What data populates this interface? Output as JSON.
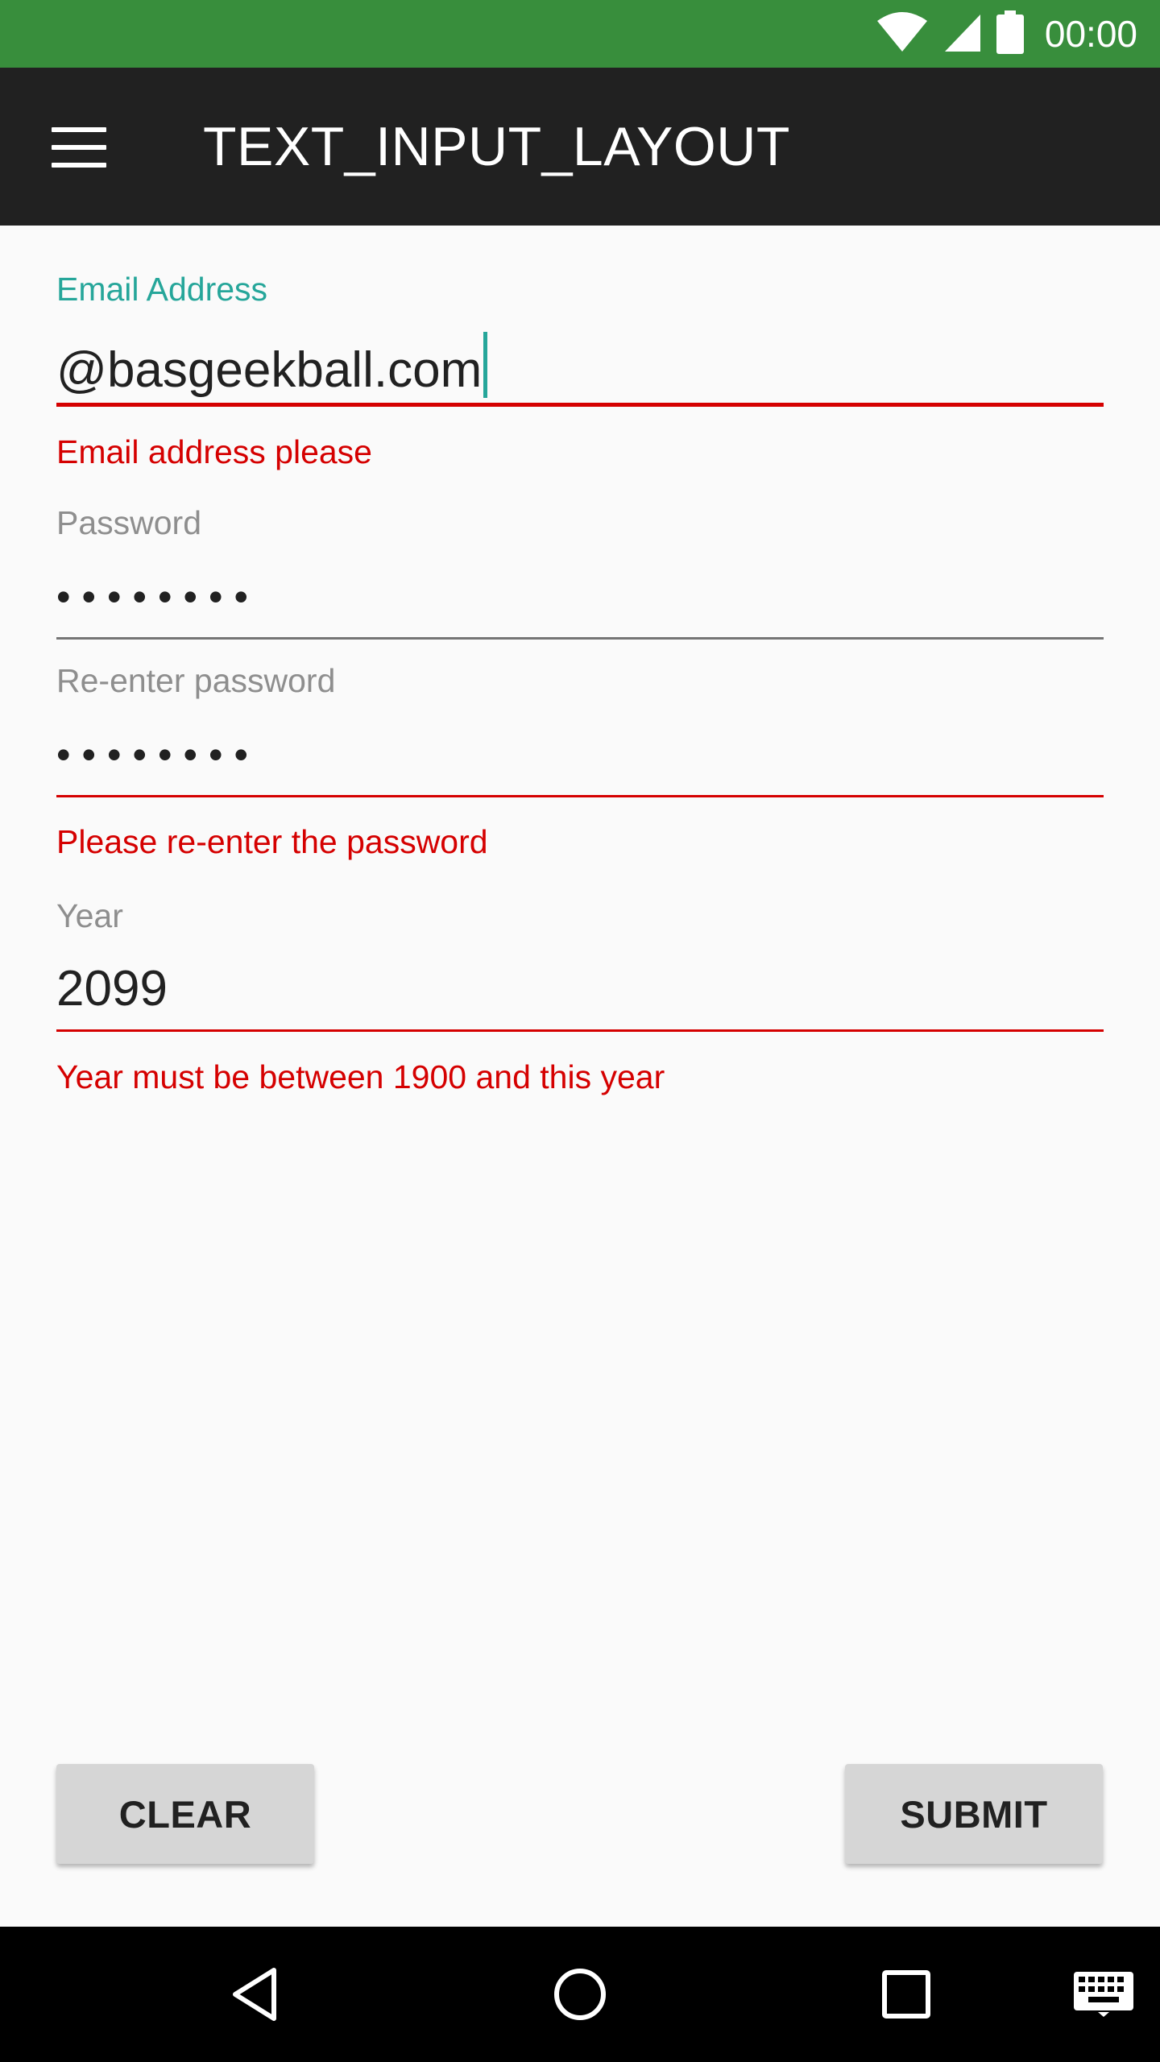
{
  "status_bar": {
    "time": "00:00",
    "icons": [
      "wifi-icon",
      "cell-signal-icon",
      "battery-icon"
    ],
    "background": "#388e3c"
  },
  "app_bar": {
    "title": "TEXT_INPUT_LAYOUT",
    "menu_icon": "hamburger-menu-icon",
    "background": "#212121"
  },
  "form": {
    "email": {
      "label": "Email Address",
      "value": "@basgeekball.com",
      "error": "Email address please",
      "focused": true
    },
    "password": {
      "label": "Password",
      "value": "••••••••"
    },
    "reenter_password": {
      "label": "Re-enter password",
      "value": "••••••••",
      "error": "Please re-enter the password"
    },
    "year": {
      "label": "Year",
      "value": "2099",
      "error": "Year must be between 1900 and this year"
    }
  },
  "buttons": {
    "clear_label": "CLEAR",
    "submit_label": "SUBMIT"
  },
  "nav_bar": {
    "icons": [
      "back-icon",
      "home-icon",
      "recents-icon",
      "keyboard-icon"
    ]
  },
  "colors": {
    "accent": "#26a69a",
    "error": "#d50000",
    "hint": "#8e8e8e"
  }
}
